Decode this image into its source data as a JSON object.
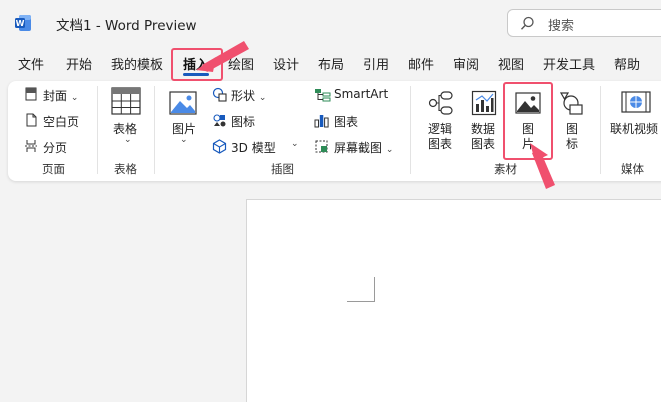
{
  "window": {
    "doc_title": "文档1  -  Word Preview",
    "search_placeholder": "搜索"
  },
  "menu": {
    "items": [
      "文件",
      "开始",
      "我的模板",
      "插入",
      "绘图",
      "设计",
      "布局",
      "引用",
      "邮件",
      "审阅",
      "视图",
      "开发工具",
      "帮助"
    ],
    "active": "插入"
  },
  "ribbon": {
    "pages": {
      "cover": "封面",
      "blank": "空白页",
      "break": "分页",
      "label": "页面"
    },
    "tables": {
      "table": "表格",
      "label": "表格"
    },
    "illustrations": {
      "picture": "图片",
      "shapes": "形状",
      "icons": "图标",
      "model3d": "3D 模型",
      "smartart": "SmartArt",
      "chart": "图表",
      "screenshot": "屏幕截图",
      "label": "插图"
    },
    "materials": {
      "logic_line1": "逻辑",
      "logic_line2": "图表",
      "data_line1": "数据",
      "data_line2": "图表",
      "picture_line1": "图",
      "picture_line2": "片",
      "icon_line1": "图",
      "icon_line2": "标",
      "label": "素材"
    },
    "media": {
      "online_video": "联机视频",
      "label": "媒体"
    }
  },
  "colors": {
    "accent": "#185abd",
    "highlight": "#f0506e",
    "word_blue": "#185abd"
  }
}
